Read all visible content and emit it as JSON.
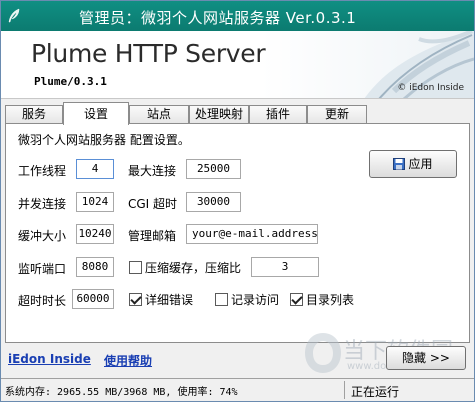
{
  "window": {
    "title": "管理员：微羽个人网站服务器 Ver.0.3.1",
    "icon": "feather-icon"
  },
  "banner": {
    "product": "Plume HTTP Server",
    "version": "Plume/0.3.1",
    "brand": "© iEdon Inside"
  },
  "tabs": [
    {
      "label": "服务",
      "active": false
    },
    {
      "label": "设置",
      "active": true
    },
    {
      "label": "站点",
      "active": false
    },
    {
      "label": "处理映射",
      "active": false
    },
    {
      "label": "插件",
      "active": false
    },
    {
      "label": "更新",
      "active": false
    }
  ],
  "settings": {
    "description": "微羽个人网站服务器 配置设置。",
    "worker_threads": {
      "label": "工作线程",
      "value": "4"
    },
    "max_connections": {
      "label": "最大连接",
      "value": "25000"
    },
    "concurrent_connections": {
      "label": "并发连接",
      "value": "1024"
    },
    "cgi_timeout": {
      "label": "CGI 超时",
      "value": "30000"
    },
    "buffer_size": {
      "label": "缓冲大小",
      "value": "10240"
    },
    "admin_email": {
      "label": "管理邮箱",
      "value": "your@e-mail.address"
    },
    "listen_port": {
      "label": "监听端口",
      "value": "8080"
    },
    "compress_cache": {
      "label": "压缩缓存，压缩比",
      "checked": false,
      "ratio": "3"
    },
    "timeout": {
      "label": "超时时长",
      "value": "60000"
    },
    "detailed_errors": {
      "label": "详细错误",
      "checked": true
    },
    "log_access": {
      "label": "记录访问",
      "checked": false
    },
    "directory_listing": {
      "label": "目录列表",
      "checked": true
    },
    "apply_label": "应用"
  },
  "footer": {
    "link_iedon": "iEdon Inside",
    "link_help": "使用帮助",
    "hide_label": "隐藏 >>"
  },
  "status": {
    "memory": "系统内存: 2965.55 MB/3968 MB, 使用率: 74%",
    "state": "正在运行"
  },
  "watermark": {
    "text": "当下软件园",
    "url": "www.downxia.com"
  }
}
